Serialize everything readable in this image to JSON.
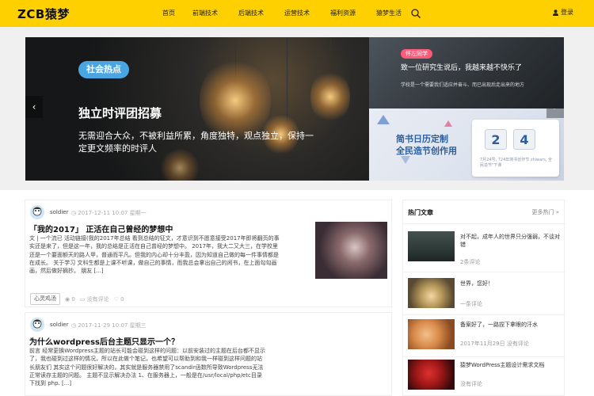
{
  "brand": {
    "logo": "ZCB猿梦",
    "accent": "#ffd000"
  },
  "nav": {
    "items": [
      {
        "label": "首页"
      },
      {
        "label": "前端技术"
      },
      {
        "label": "后端技术"
      },
      {
        "label": "运营技术"
      },
      {
        "label": "福利资源"
      },
      {
        "label": "猿梦生活"
      }
    ],
    "search_icon": "search-icon",
    "login_label": "登录"
  },
  "banner": {
    "main": {
      "tag": "社会热点",
      "title": "独立时评团招募",
      "desc": "无需迎合大众，不被利益所累，角度独特，观点独立，保持一定更文频率的时评人"
    },
    "top": {
      "tag": "怀左同学",
      "title": "致一位研究生说后，我越来越不快乐了",
      "desc": "学校是一个需要我们适应并奋斗、而已出现后走出来的地方"
    },
    "bottom": {
      "title": "简书日历定制",
      "subtitle": "全民造节创作用",
      "digit1": "2",
      "digit2": "4",
      "note": "7月24号, 724年简书创作节 zhiwars, 全民造节\"下课"
    },
    "prev_label": "‹",
    "next_label": "›"
  },
  "posts": [
    {
      "author": "soldier",
      "date": "2017-12-11 10:07 星期一",
      "title": "「我的2017」 正活在自己曾经的梦想中",
      "excerpt": "文 | 一个流已 活动链接(我的2017年总结 看到总结的征文，才意识到不愿意接受2017年即将翻页的事实还是来了，但是这一年，我的总结是正活在自己曾经的梦想中。 2017年，我大二又大三，在学校里还是一个要面额天的路人甲，普通而平凡。但我的内心却十分丰盈，因为知道自己做的每一件事情都是在成长。 关于学习 文科生都是上课不听课，做自己的事情，而我总会拿出自己的闲书，在上面勾勾画画，然后做好摘抄。 朋友 [...]",
      "tag": "心灵鸡汤",
      "views": "0",
      "comments": "没有评论",
      "likes": "0"
    },
    {
      "author": "soldier",
      "date": "2017-11-29 10:07 星期三",
      "title": "为什么wordpress后台主题只显示一个？",
      "excerpt": "前言 经常更换Wordpress主题的站长可能会碰到这样的问题：以前安装过的主题在后台都不显示了，我也碰到过这样的情况，所以在此做个笔记，也希望可以帮助到和我一样碰到这样问题的站长朋友们 其实这个问题很好解决的，其实就是服务器禁用了scandir函数所导致Wordpress无法正常读存主题的问题。 主题不显示解决办法 1、在服务器上，一般是在/usr/local/php/etc目录下找到 php. [...]"
    }
  ],
  "sidebar": {
    "title": "热门文章",
    "more": "更多热门 »",
    "items": [
      {
        "title": "对不起，成年人的世界只分强弱，不谈对错",
        "meta": "2条评论"
      },
      {
        "title": "世界，您好！",
        "meta": "一条评论"
      },
      {
        "title": "备案好了，一路捏下拿眼的汗水",
        "meta": "2017年11月29日    没有评论"
      },
      {
        "title": "猿梦WordPress主题设计需求文档",
        "meta": "没有评论"
      }
    ]
  }
}
